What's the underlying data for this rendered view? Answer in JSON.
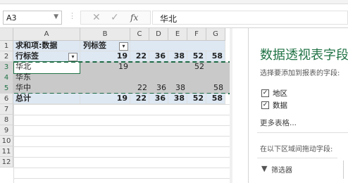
{
  "namebox": {
    "value": "A3"
  },
  "formula": {
    "cancel": "✕",
    "confirm": "✓",
    "fx": "fx",
    "value": "华北"
  },
  "columns": [
    "A",
    "B",
    "C",
    "D",
    "E",
    "F",
    "G"
  ],
  "rows": [
    "1",
    "2",
    "3",
    "4",
    "5",
    "6",
    "7",
    "8",
    "9",
    "10",
    "11",
    "12"
  ],
  "pivot": {
    "header_values": "求和项:数据",
    "header_cols": "列标签",
    "row_labels": "行标签",
    "col_values": [
      "19",
      "22",
      "36",
      "38",
      "52",
      "58"
    ],
    "items": [
      {
        "label": "华北",
        "values": [
          "19",
          "",
          "",
          "",
          "52",
          ""
        ]
      },
      {
        "label": "华东",
        "values": [
          "",
          "",
          "",
          "",
          "",
          ""
        ]
      },
      {
        "label": "华中",
        "values": [
          "",
          "22",
          "36",
          "38",
          "",
          "58"
        ]
      }
    ],
    "total": {
      "label": "总计",
      "values": [
        "19",
        "22",
        "36",
        "38",
        "52",
        "58"
      ]
    }
  },
  "pane": {
    "title": "数据透视表字段",
    "subtitle": "选择要添加到报表的字段:",
    "fields": [
      {
        "label": "地区",
        "checked": true
      },
      {
        "label": "数据",
        "checked": true
      }
    ],
    "more": "更多表格...",
    "areas_hint": "在以下区域间拖动字段:",
    "filter_label": "筛选器"
  },
  "colors": {
    "accent": "#217346",
    "pivot_band": "#dde8f3",
    "selection_band": "#c9c9c9"
  }
}
